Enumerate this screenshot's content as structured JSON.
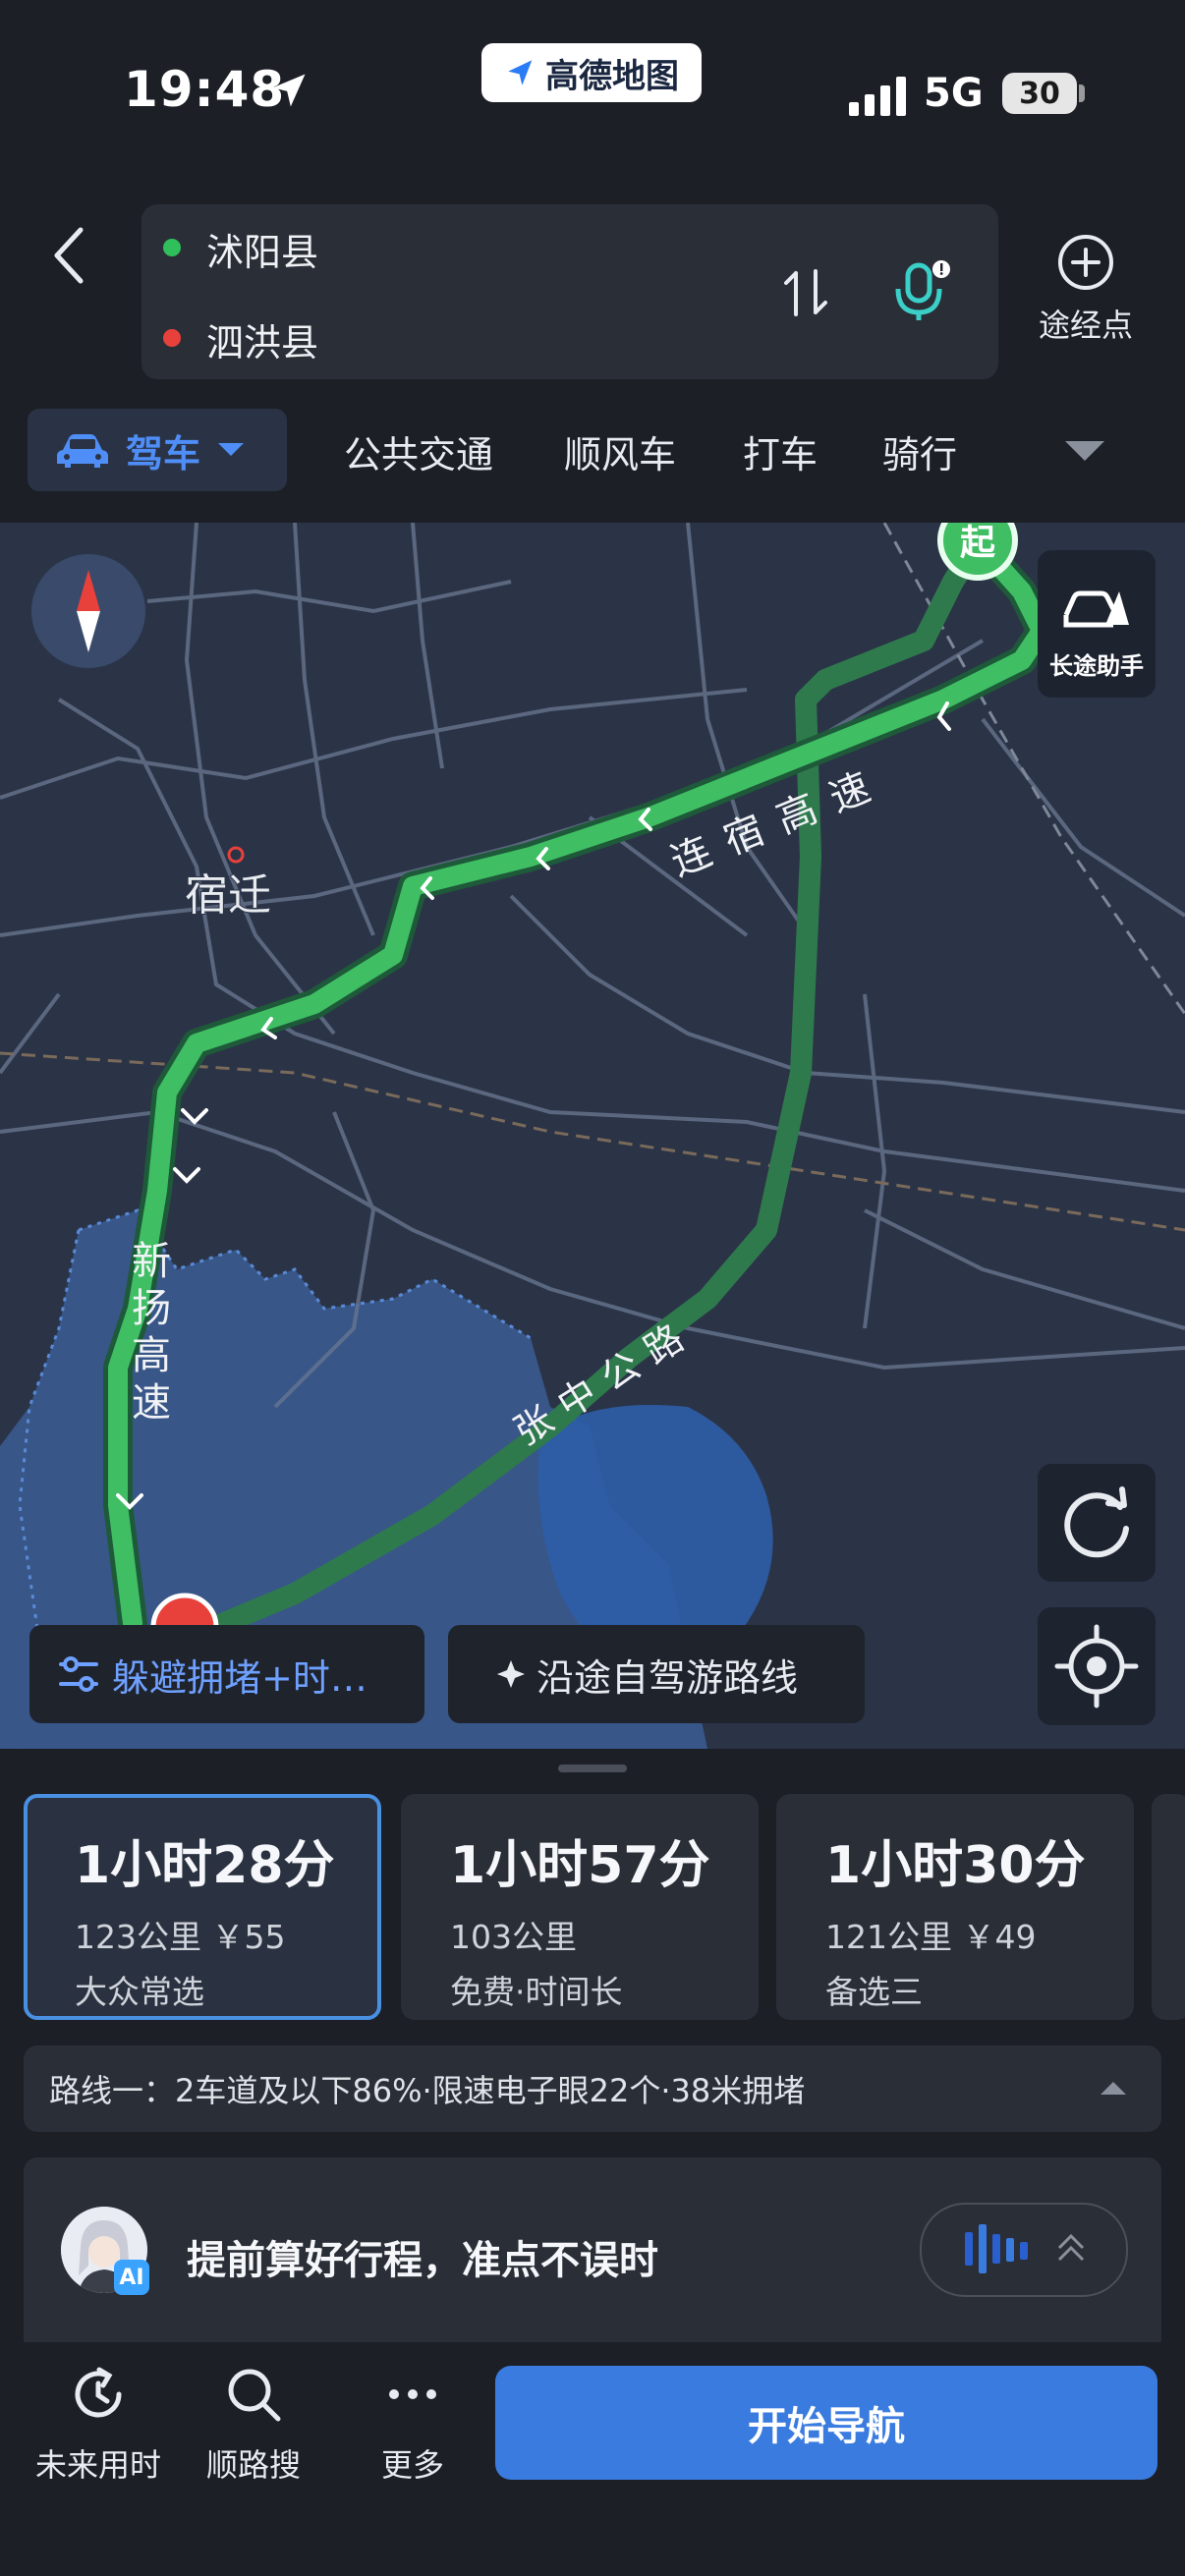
{
  "status_bar": {
    "time": "19:48",
    "network": "5G",
    "battery": "30"
  },
  "app_badge": {
    "name": "高德地图"
  },
  "route": {
    "origin": "沭阳县",
    "destination": "泗洪县"
  },
  "waypoint": {
    "label": "途经点"
  },
  "modes": {
    "selected": "驾车",
    "items": [
      "公共交通",
      "顺风车",
      "打车",
      "骑行"
    ]
  },
  "map": {
    "city_label": "宿迁",
    "road_labels": {
      "lianxu": "连宿高速",
      "xinyang": "新扬高速",
      "zhangzhong": "张中公路",
      "start_marker": "起"
    },
    "long_trip_label": "长途助手"
  },
  "chips": {
    "avoid": "躲避拥堵+时…",
    "self_drive": "沿途自驾游路线"
  },
  "route_options": [
    {
      "time": "1小时28分",
      "info": "123公里 ￥55",
      "tag": "大众常选"
    },
    {
      "time": "1小时57分",
      "info": "103公里",
      "tag": "免费·时间长"
    },
    {
      "time": "1小时30分",
      "info": "121公里 ￥49",
      "tag": "备选三"
    }
  ],
  "route_detail": "路线一：2车道及以下86%·限速电子眼22个·38米拥堵",
  "ai_card": {
    "badge": "AI",
    "text": "提前算好行程，准点不误时"
  },
  "toolbar": {
    "future_time": "未来用时",
    "search_along": "顺路搜",
    "more": "更多",
    "start_nav": "开始导航"
  },
  "colors": {
    "accent": "#3a7be0",
    "route_green": "#2f8a52",
    "origin_green": "#2fbf5b",
    "destination_red": "#e8413c"
  }
}
